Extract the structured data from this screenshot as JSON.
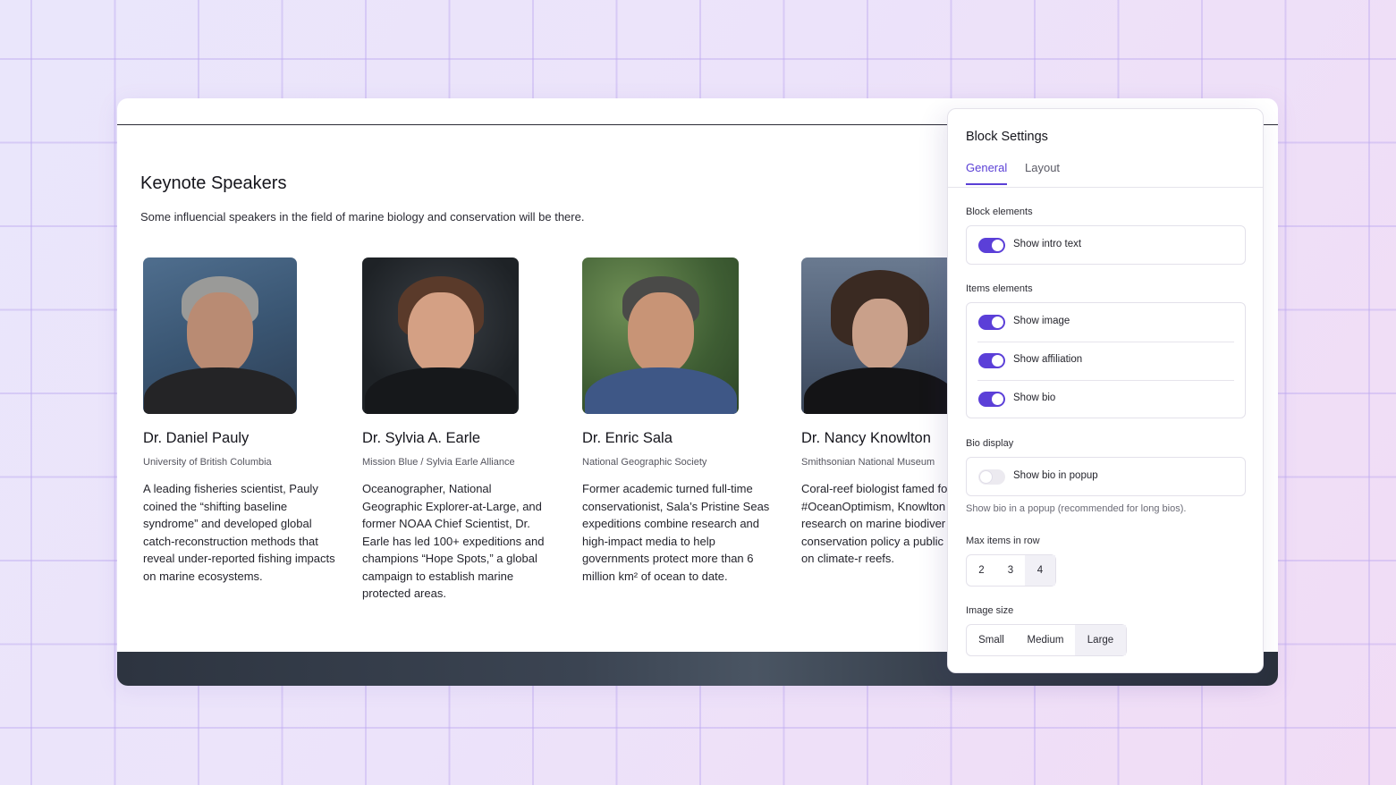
{
  "page": {
    "title": "Keynote Speakers",
    "intro": "Some influencial speakers in the field of marine biology and conservation will be there."
  },
  "speakers": [
    {
      "name": "Dr. Daniel Pauly",
      "affiliation": "University of British Columbia",
      "bio": "A leading fisheries scientist, Pauly coined the “shifting baseline syndrome” and developed global catch-reconstruction methods that reveal under-reported fishing impacts on marine ecosystems."
    },
    {
      "name": "Dr. Sylvia A. Earle",
      "affiliation": "Mission Blue / Sylvia Earle Alliance",
      "bio": "Oceanographer, National Geographic Explorer-at-Large, and former NOAA Chief Scientist, Dr. Earle has led 100+ expeditions and champions “Hope Spots,” a global campaign to establish marine protected areas."
    },
    {
      "name": "Dr. Enric Sala",
      "affiliation": "National Geographic Society",
      "bio": "Former academic turned full-time conservationist, Sala’s Pristine Seas expeditions combine research and high-impact media to help governments protect more than 6 million km² of ocean to date."
    },
    {
      "name": "Dr. Nancy Knowlton",
      "affiliation": "Smithsonian National Museum",
      "bio": "Coral-reef biologist famed fo #OceanOptimism, Knowlton research on marine biodiver guides conservation policy a public outreach on climate-r reefs."
    }
  ],
  "settings": {
    "title": "Block Settings",
    "tabs": [
      "General",
      "Layout"
    ],
    "active_tab": "General",
    "block_elements_label": "Block elements",
    "block_toggles": [
      {
        "label": "Show intro text",
        "on": true
      }
    ],
    "items_elements_label": "Items elements",
    "item_toggles": [
      {
        "label": "Show image",
        "on": true
      },
      {
        "label": "Show affiliation",
        "on": true
      },
      {
        "label": "Show bio",
        "on": true
      }
    ],
    "bio_display_label": "Bio display",
    "bio_toggle": {
      "label": "Show bio in popup",
      "on": false
    },
    "bio_help": "Show bio in a popup (recommended for long bios).",
    "max_items_label": "Max items in row",
    "max_items_options": [
      "2",
      "3",
      "4"
    ],
    "max_items_selected": "4",
    "image_size_label": "Image size",
    "image_size_options": [
      "Small",
      "Medium",
      "Large"
    ],
    "image_size_selected": "Large"
  },
  "colors": {
    "accent": "#5a3fd6"
  }
}
